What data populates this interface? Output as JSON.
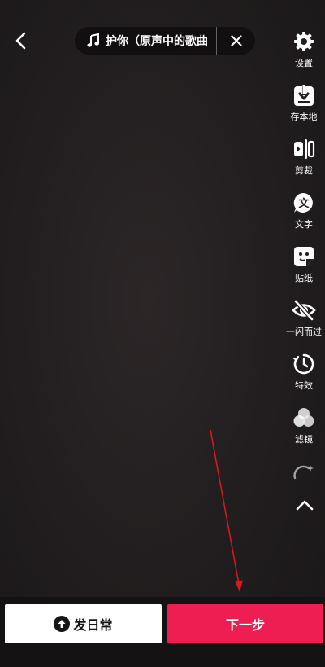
{
  "header": {
    "music_title": "护你（原声中的歌曲"
  },
  "toolbar": {
    "items": [
      {
        "label": "设置",
        "icon": "gear-icon"
      },
      {
        "label": "存本地",
        "icon": "download-icon"
      },
      {
        "label": "剪裁",
        "icon": "trim-icon"
      },
      {
        "label": "文字",
        "icon": "text-icon"
      },
      {
        "label": "贴纸",
        "icon": "sticker-icon"
      },
      {
        "label": "一闪而过",
        "icon": "eye-off-icon"
      },
      {
        "label": "特效",
        "icon": "effects-icon"
      },
      {
        "label": "滤镜",
        "icon": "filter-icon"
      }
    ]
  },
  "footer": {
    "daily_label": "发日常",
    "next_label": "下一步"
  },
  "colors": {
    "accent": "#ee1d52",
    "annotation_arrow": "#d7191c"
  }
}
